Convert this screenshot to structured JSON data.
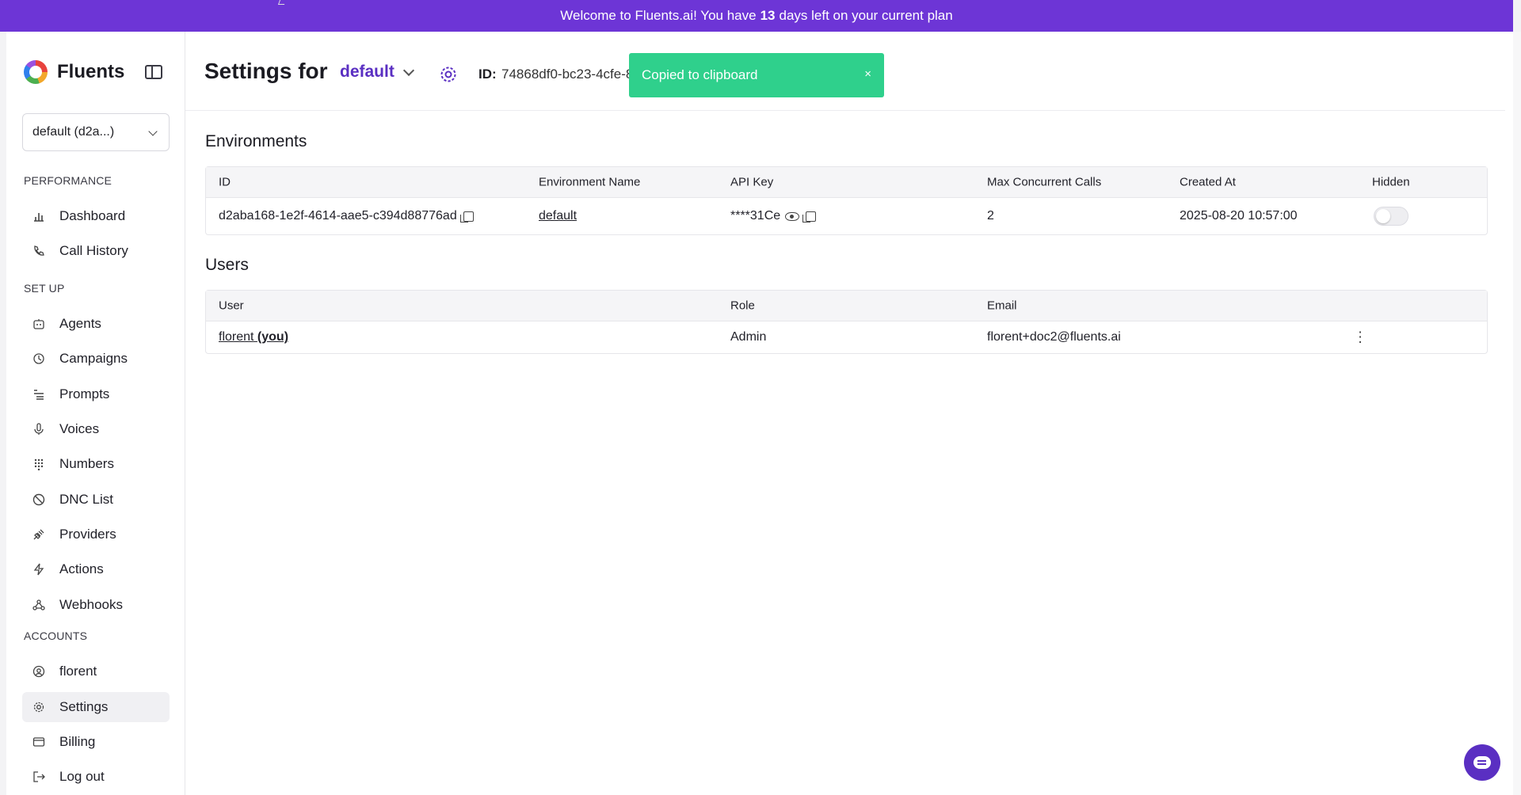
{
  "banner": {
    "prefix": "Welcome to Fluents.ai! You have",
    "days": "13",
    "suffix": "days left on your current plan"
  },
  "brand": {
    "name": "Fluents"
  },
  "sidebar": {
    "env_select": "default (d2a...)",
    "sections": [
      {
        "label": "PERFORMANCE",
        "items": [
          {
            "label": "Dashboard",
            "icon": "bar-chart-icon"
          },
          {
            "label": "Call History",
            "icon": "phone-icon"
          }
        ]
      },
      {
        "label": "SET UP",
        "items": [
          {
            "label": "Agents",
            "icon": "robot-icon"
          },
          {
            "label": "Campaigns",
            "icon": "campaign-icon"
          },
          {
            "label": "Prompts",
            "icon": "list-icon"
          },
          {
            "label": "Voices",
            "icon": "microphone-icon"
          },
          {
            "label": "Numbers",
            "icon": "dialpad-icon"
          },
          {
            "label": "DNC List",
            "icon": "ban-icon"
          },
          {
            "label": "Providers",
            "icon": "plug-icon"
          },
          {
            "label": "Actions",
            "icon": "bolt-icon"
          },
          {
            "label": "Webhooks",
            "icon": "webhook-icon"
          }
        ]
      },
      {
        "label": "ACCOUNTS",
        "items": [
          {
            "label": "florent",
            "icon": "user-circle-icon"
          },
          {
            "label": "Settings",
            "icon": "gear-icon",
            "active": true
          },
          {
            "label": "Billing",
            "icon": "wallet-icon"
          },
          {
            "label": "Log out",
            "icon": "logout-icon"
          }
        ]
      }
    ]
  },
  "header": {
    "title": "Settings for",
    "env_name": "default",
    "id_label": "ID:",
    "id_value": "74868df0-bc23-4cfe-8"
  },
  "toast": {
    "message": "Copied to clipboard",
    "close": "×"
  },
  "environments": {
    "heading": "Environments",
    "columns": [
      "ID",
      "Environment Name",
      "API Key",
      "Max Concurrent Calls",
      "Created At",
      "Hidden"
    ],
    "rows": [
      {
        "id": "d2aba168-1e2f-4614-aae5-c394d88776ad",
        "name": "default",
        "api_key": "****31Ce",
        "max_calls": "2",
        "created_at": "2025-08-20 10:57:00",
        "hidden": false
      }
    ]
  },
  "users": {
    "heading": "Users",
    "columns": [
      "User",
      "Role",
      "Email"
    ],
    "rows": [
      {
        "user": "florent",
        "you": "(you)",
        "role": "Admin",
        "email": "florent+doc2@fluents.ai"
      }
    ]
  },
  "colors": {
    "brand_purple": "#6d35d6",
    "accent": "#5a2fc2",
    "toast_green": "#2fd08c"
  }
}
